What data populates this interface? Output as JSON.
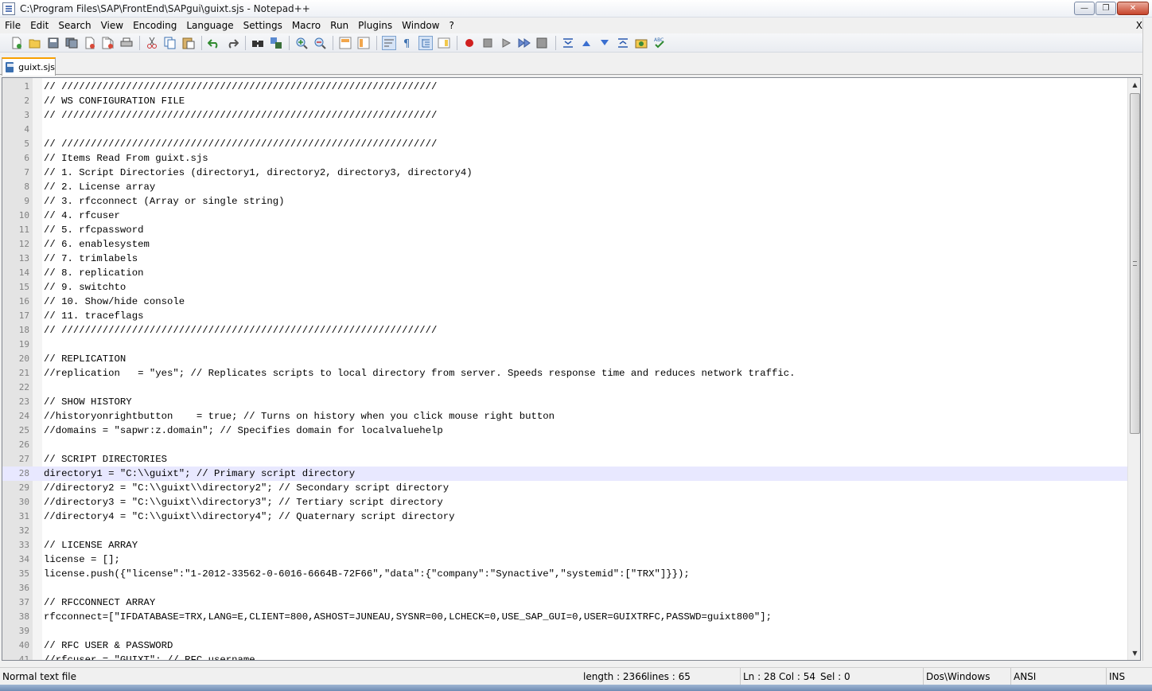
{
  "window": {
    "title": "C:\\Program Files\\SAP\\FrontEnd\\SAPgui\\guixt.sjs - Notepad++",
    "minimize_glyph": "—",
    "restore_glyph": "❐",
    "close_glyph": "✕"
  },
  "menu": {
    "items": [
      "File",
      "Edit",
      "Search",
      "View",
      "Encoding",
      "Language",
      "Settings",
      "Macro",
      "Run",
      "Plugins",
      "Window",
      "?"
    ],
    "close_doc": "X"
  },
  "toolbar": {
    "icons": [
      "new-file-icon",
      "open-file-icon",
      "save-icon",
      "save-all-icon",
      "close-icon",
      "close-all-icon",
      "print-icon",
      "cut-icon",
      "copy-icon",
      "paste-icon",
      "undo-icon",
      "redo-icon",
      "find-icon",
      "replace-icon",
      "zoom-in-icon",
      "zoom-out-icon",
      "sync-vertical-icon",
      "sync-horizontal-icon",
      "word-wrap-icon",
      "show-all-chars-icon",
      "indent-guide-icon",
      "doc-map-icon",
      "record-macro-icon",
      "stop-record-icon",
      "play-macro-icon",
      "run-macro-multiple-icon",
      "save-macro-icon",
      "fold-all-icon",
      "prev-bookmark-icon",
      "next-bookmark-icon",
      "unfold-all-icon",
      "launch-browser-icon",
      "spell-check-icon"
    ]
  },
  "tab": {
    "label": "guixt.sjs"
  },
  "editor": {
    "current_line": 28,
    "lines": [
      "// ////////////////////////////////////////////////////////////////",
      "// WS CONFIGURATION FILE",
      "// ////////////////////////////////////////////////////////////////",
      "",
      "// ////////////////////////////////////////////////////////////////",
      "// Items Read From guixt.sjs",
      "// 1. Script Directories (directory1, directory2, directory3, directory4)",
      "// 2. License array",
      "// 3. rfcconnect (Array or single string)",
      "// 4. rfcuser",
      "// 5. rfcpassword",
      "// 6. enablesystem",
      "// 7. trimlabels",
      "// 8. replication",
      "// 9. switchto",
      "// 10. Show/hide console",
      "// 11. traceflags",
      "// ////////////////////////////////////////////////////////////////",
      "",
      "// REPLICATION",
      "//replication   = \"yes\"; // Replicates scripts to local directory from server. Speeds response time and reduces network traffic.",
      "",
      "// SHOW HISTORY",
      "//historyonrightbutton    = true; // Turns on history when you click mouse right button",
      "//domains = \"sapwr:z.domain\"; // Specifies domain for localvaluehelp",
      "",
      "// SCRIPT DIRECTORIES",
      "directory1 = \"C:\\\\guixt\"; // Primary script directory",
      "//directory2 = \"C:\\\\guixt\\\\directory2\"; // Secondary script directory",
      "//directory3 = \"C:\\\\guixt\\\\directory3\"; // Tertiary script directory",
      "//directory4 = \"C:\\\\guixt\\\\directory4\"; // Quaternary script directory",
      "",
      "// LICENSE ARRAY",
      "license = [];",
      "license.push({\"license\":\"1-2012-33562-0-6016-6664B-72F66\",\"data\":{\"company\":\"Synactive\",\"systemid\":[\"TRX\"]}});",
      "",
      "// RFCCONNECT ARRAY",
      "rfcconnect=[\"IFDATABASE=TRX,LANG=E,CLIENT=800,ASHOST=JUNEAU,SYSNR=00,LCHECK=0,USE_SAP_GUI=0,USER=GUIXTRFC,PASSWD=guixt800\"];",
      "",
      "// RFC USER & PASSWORD",
      "//rfcuser = \"GUIXT\"; // RFC username"
    ]
  },
  "status": {
    "file_type": "Normal text file",
    "length": "length : 2366",
    "lines": "lines : 65",
    "ln": "Ln : 28",
    "col": "Col : 54",
    "sel": "Sel : 0",
    "eol": "Dos\\Windows",
    "encoding": "ANSI",
    "mode": "INS"
  }
}
